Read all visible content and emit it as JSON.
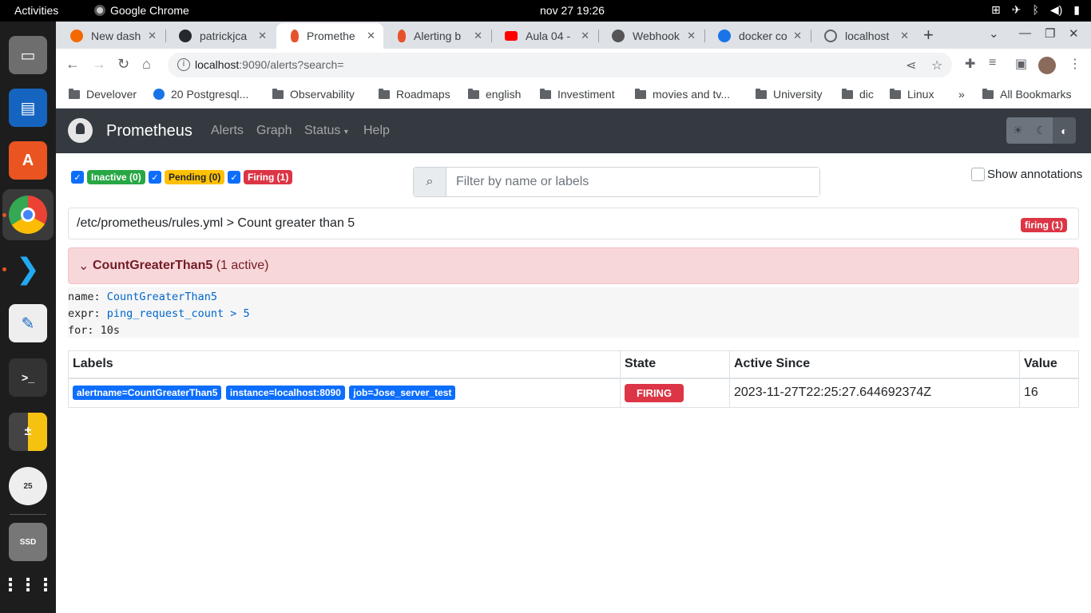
{
  "os": {
    "activities": "Activities",
    "app_name": "Google Chrome",
    "clock": "nov 27  19:26"
  },
  "browser": {
    "tabs": [
      {
        "title": "New dash",
        "icon": "grafana-icon",
        "color": "#f46800"
      },
      {
        "title": "patrickjca",
        "icon": "github-icon",
        "color": "#24292f"
      },
      {
        "title": "Promethe",
        "icon": "prometheus-icon",
        "color": "#e6522c"
      },
      {
        "title": "Alerting b",
        "icon": "prometheus-icon",
        "color": "#e6522c"
      },
      {
        "title": "Aula 04 -",
        "icon": "youtube-icon",
        "color": "#ff0000"
      },
      {
        "title": "Webhook",
        "icon": "webhook-icon",
        "color": "#555555"
      },
      {
        "title": "docker co",
        "icon": "edge-icon",
        "color": "#1a73e8"
      },
      {
        "title": "localhost",
        "icon": "globe-icon",
        "color": "#5f6368"
      }
    ],
    "url_host": "localhost",
    "url_rest": ":9090/alerts?search=",
    "bookmarks": [
      "Develover",
      "20 Postgresql...",
      "Observability",
      "Roadmaps",
      "english",
      "Investiment",
      "movies and tv...",
      "University",
      "dic",
      "Linux"
    ],
    "more": "»",
    "all_bookmarks": "All Bookmarks"
  },
  "prometheus": {
    "brand": "Prometheus",
    "nav": {
      "alerts": "Alerts",
      "graph": "Graph",
      "status": "Status",
      "help": "Help"
    },
    "filters": {
      "inactive": "Inactive (0)",
      "pending": "Pending (0)",
      "firing": "Firing (1)"
    },
    "search_placeholder": "Filter by name or labels",
    "show_annotations": "Show annotations",
    "group": {
      "name": "/etc/prometheus/rules.yml > Count greater than 5",
      "badge": "firing (1)"
    },
    "alert": {
      "name": "CountGreaterThan5",
      "active": "(1 active)",
      "rule_name_key": "name:",
      "rule_name_val": "CountGreaterThan5",
      "expr_key": "expr:",
      "expr_val": "ping_request_count > 5",
      "for_key": "for:",
      "for_val": "10s"
    },
    "table": {
      "headers": [
        "Labels",
        "State",
        "Active Since",
        "Value"
      ],
      "rows": [
        {
          "labels": [
            "alertname=CountGreaterThan5",
            "instance=localhost:8090",
            "job=Jose_server_test"
          ],
          "state": "FIRING",
          "active_since": "2023-11-27T22:25:27.644692374Z",
          "value": "16"
        }
      ]
    }
  }
}
